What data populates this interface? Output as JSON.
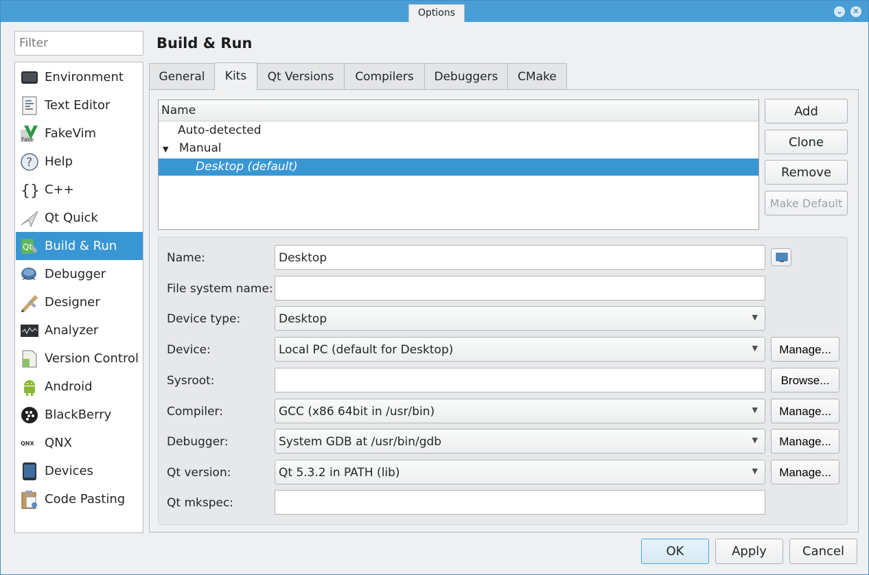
{
  "window": {
    "title": "Options"
  },
  "titlebar_buttons": {
    "minimize": "⌄",
    "close": "✕"
  },
  "filter": {
    "placeholder": "Filter"
  },
  "sidebar": {
    "items": [
      {
        "label": "Environment",
        "icon": "monitor-icon"
      },
      {
        "label": "Text Editor",
        "icon": "text-document-icon"
      },
      {
        "label": "FakeVim",
        "icon": "fakevim-icon"
      },
      {
        "label": "Help",
        "icon": "help-icon"
      },
      {
        "label": "C++",
        "icon": "braces-icon"
      },
      {
        "label": "Qt Quick",
        "icon": "paper-plane-icon"
      },
      {
        "label": "Build & Run",
        "icon": "qt-build-icon",
        "selected": true
      },
      {
        "label": "Debugger",
        "icon": "bug-icon"
      },
      {
        "label": "Designer",
        "icon": "designer-icon"
      },
      {
        "label": "Analyzer",
        "icon": "analyzer-icon"
      },
      {
        "label": "Version Control",
        "icon": "version-control-icon"
      },
      {
        "label": "Android",
        "icon": "android-icon"
      },
      {
        "label": "BlackBerry",
        "icon": "blackberry-icon"
      },
      {
        "label": "QNX",
        "icon": "qnx-icon"
      },
      {
        "label": "Devices",
        "icon": "device-icon"
      },
      {
        "label": "Code Pasting",
        "icon": "clipboard-icon"
      }
    ]
  },
  "page": {
    "title": "Build & Run"
  },
  "tabs": [
    {
      "label": "General"
    },
    {
      "label": "Kits",
      "active": true
    },
    {
      "label": "Qt Versions"
    },
    {
      "label": "Compilers"
    },
    {
      "label": "Debuggers"
    },
    {
      "label": "CMake"
    }
  ],
  "kits": {
    "header": "Name",
    "rows": [
      {
        "label": "Auto-detected"
      },
      {
        "label": "Manual",
        "expanded": true
      },
      {
        "label": "Desktop (default)",
        "selected": true
      }
    ],
    "buttons": {
      "add": "Add",
      "clone": "Clone",
      "remove": "Remove",
      "make_default": "Make Default"
    }
  },
  "details": {
    "name": {
      "label": "Name:",
      "value": "Desktop"
    },
    "fs_name": {
      "label": "File system name:",
      "value": ""
    },
    "device_type": {
      "label": "Device type:",
      "value": "Desktop"
    },
    "device": {
      "label": "Device:",
      "value": "Local PC (default for Desktop)",
      "button": "Manage..."
    },
    "sysroot": {
      "label": "Sysroot:",
      "value": "",
      "button": "Browse..."
    },
    "compiler": {
      "label": "Compiler:",
      "value": "GCC (x86 64bit in /usr/bin)",
      "button": "Manage..."
    },
    "debugger": {
      "label": "Debugger:",
      "value": "System GDB at /usr/bin/gdb",
      "button": "Manage..."
    },
    "qt_version": {
      "label": "Qt version:",
      "value": "Qt 5.3.2 in PATH (lib)",
      "button": "Manage..."
    },
    "qt_mkspec": {
      "label": "Qt mkspec:",
      "value": ""
    }
  },
  "footer": {
    "ok": "OK",
    "apply": "Apply",
    "cancel": "Cancel"
  },
  "colors": {
    "accent": "#3896d3",
    "titlebar": "#4a9ed6",
    "window_bg": "#eff0f1"
  }
}
